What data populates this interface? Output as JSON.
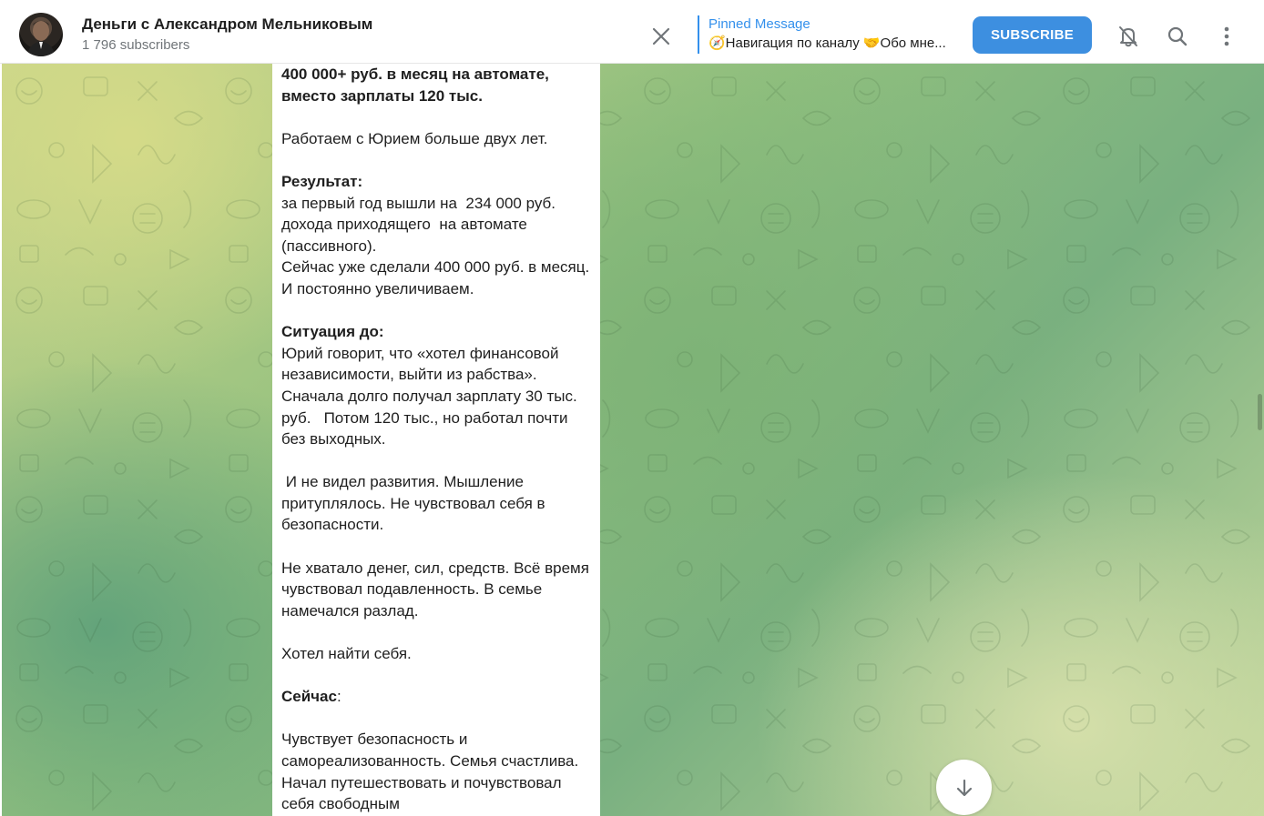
{
  "header": {
    "title": "Деньги с Александром Мельниковым",
    "subscribers": "1 796 subscribers",
    "pinned_title": "Pinned Message",
    "pinned_text": "🧭Навигация по каналу 🤝Обо мне...",
    "subscribe_label": "SUBSCRIBE",
    "icons": [
      "close-icon",
      "mute-icon",
      "search-icon",
      "more-icon"
    ]
  },
  "message": {
    "line_01": "400 000+ руб. в месяц на автомате, вместо зарплаты 120 тыс.",
    "line_02": "Работаем с Юрием больше двух лет.",
    "line_03_heading": "Результат:",
    "line_04": "за первый год вышли на  234 000 руб. дохода приходящего  на автомате (пассивного).\nСейчас уже сделали 400 000 руб. в месяц. И постоянно увеличиваем.",
    "line_05_heading": "Ситуация до:",
    "line_06": "Юрий говорит, что «хотел финансовой независимости, выйти из рабства». Сначала долго получал зарплату 30 тыс. руб.   Потом 120 тыс., но работал почти без выходных.",
    "line_07": " И не видел развития. Мышление притуплялось. Не чувствовал себя в безопасности.",
    "line_08": "Не хватало денег, сил, средств. Всё время чувствовал подавленность. В семье намечался разлад.",
    "line_09": "Хотел найти себя.",
    "line_10_heading": "Сейчас",
    "line_10_colon": ":",
    "line_11": "Чувствует безопасность и самореализованность. Семья счастлива. Начал путешествовать и почувствовал себя свободным"
  },
  "colors": {
    "accent": "#3390ec",
    "subscribe_bg": "#3d8fe0",
    "muted_text": "#707579"
  }
}
